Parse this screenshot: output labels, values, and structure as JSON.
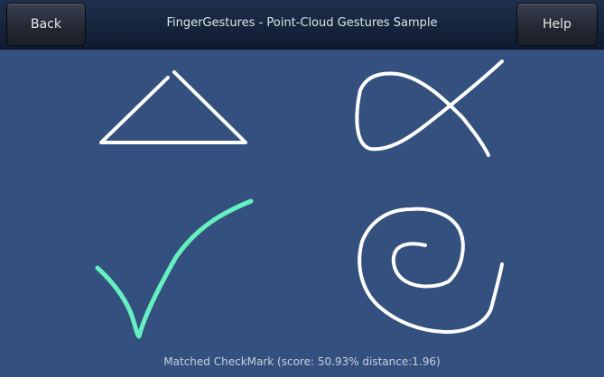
{
  "header": {
    "title": "FingerGestures - Point-Cloud Gestures Sample",
    "back_label": "Back",
    "help_label": "Help"
  },
  "gestures": [
    {
      "name": "triangle",
      "color": "#ffffff"
    },
    {
      "name": "fish",
      "color": "#ffffff"
    },
    {
      "name": "checkmark",
      "color": "#66f0c0",
      "matched": true
    },
    {
      "name": "spiral",
      "color": "#ffffff"
    }
  ],
  "status": {
    "text": "Matched CheckMark (score: 50.93% distance:1.96)"
  },
  "colors": {
    "background": "#33507f",
    "stroke": "#ffffff",
    "matched": "#66f0c0"
  }
}
